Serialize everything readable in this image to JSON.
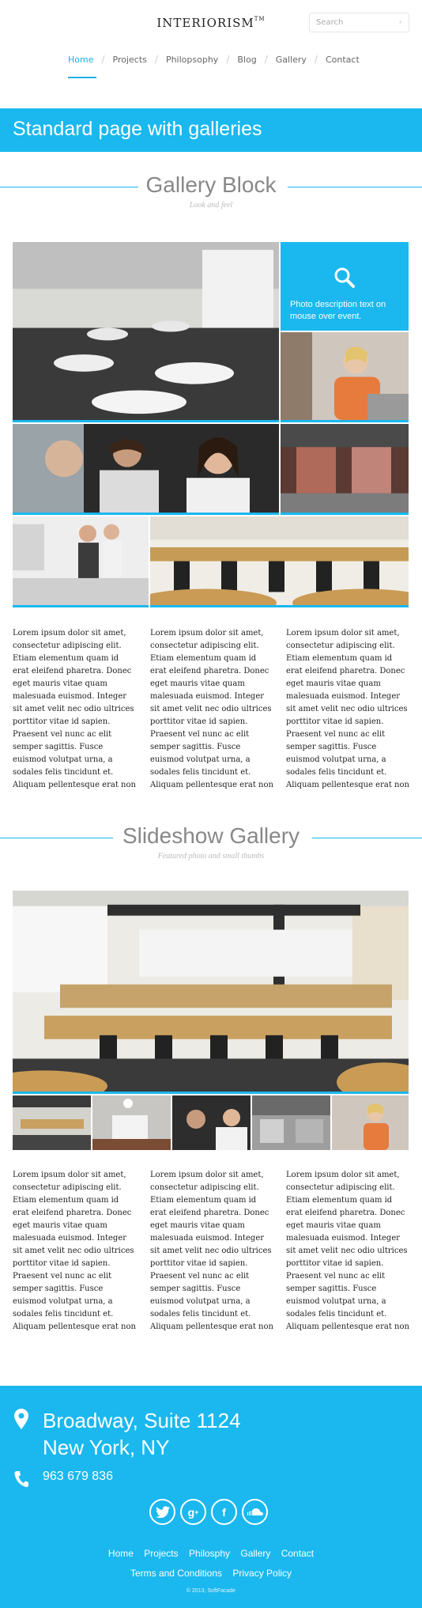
{
  "header": {
    "logo": "INTERIORISM",
    "logo_tm": "TM",
    "search_placeholder": "Search"
  },
  "nav": {
    "items": [
      "Home",
      "Projects",
      "Philopsophy",
      "Blog",
      "Gallery",
      "Contact"
    ],
    "active": "Home"
  },
  "page_title": "Standard page with galleries",
  "gallery_block": {
    "title": "Gallery Block",
    "subtitle": "Look and feel",
    "overlay_text": "Photo description text on mouse over event."
  },
  "lorem": "Lorem ipsum dolor sit amet, consectetur adipiscing elit. Etiam elementum quam id erat eleifend pharetra. Donec eget mauris vitae quam malesuada euismod. Integer sit amet velit nec odio ultrices porttitor vitae id sapien. Praesent vel nunc ac elit semper sagittis. Fusce euismod volutpat urna, a sodales felis tincidunt et. Aliquam pellentesque erat non",
  "slideshow": {
    "title": "Slideshow Gallery",
    "subtitle": "Featured photo and small thumbs"
  },
  "footer": {
    "address_line1": "Broadway, Suite 1124",
    "address_line2": "New York, NY",
    "phone": "963 679 836",
    "social": [
      "twitter-icon",
      "google-plus-icon",
      "facebook-icon",
      "soundcloud-icon"
    ],
    "links_row1": [
      "Home",
      "Projects",
      "Philosphy",
      "Gallery",
      "Contact"
    ],
    "links_row2": [
      "Terms and Conditions",
      "Privacy Policy"
    ],
    "copyright": "© 2013, SoftFacade"
  },
  "colors": {
    "accent": "#1ab8ee"
  }
}
